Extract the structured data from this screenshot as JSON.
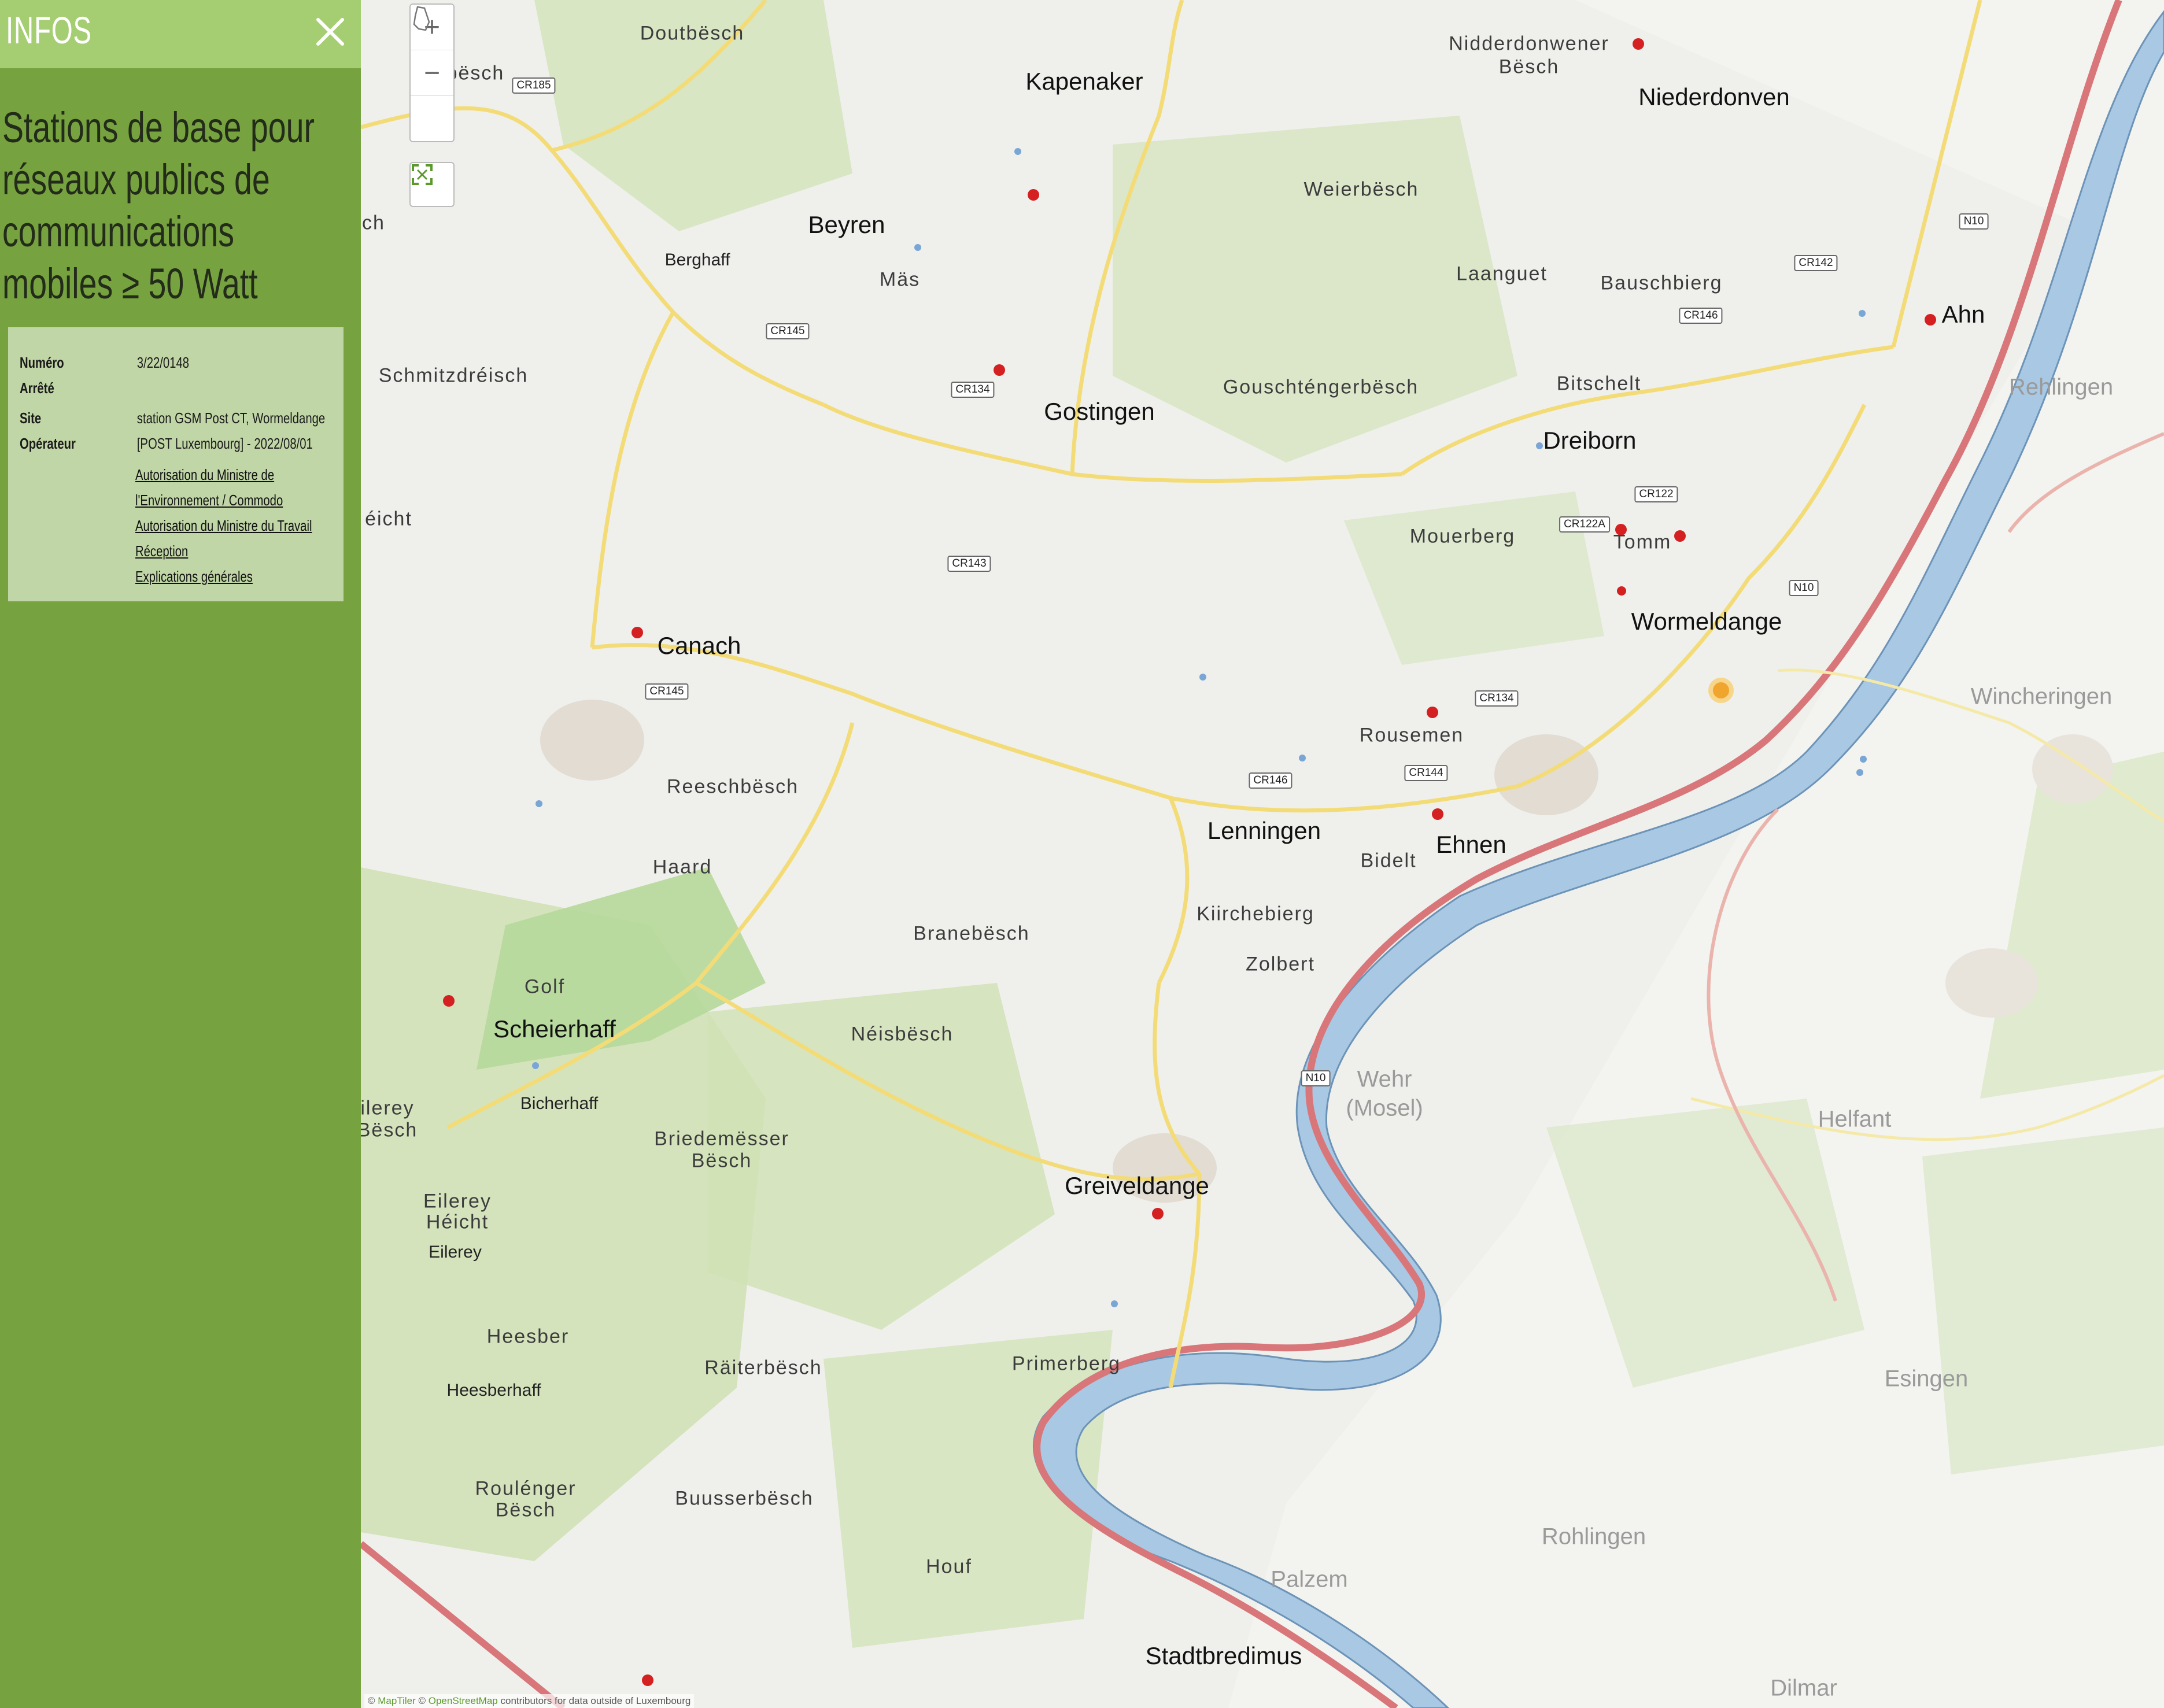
{
  "sidebar": {
    "title": "INFOS",
    "layer_title_lines": [
      "Stations de base pour",
      "réseaux publics de",
      "communications",
      "mobiles ≥ 50 Watt"
    ],
    "info": {
      "numero_label": "Numéro",
      "arrete_label": "Arrêté",
      "numero_value": "3/22/0148",
      "site_label": "Site",
      "site_value": "station GSM Post CT, Wormeldange",
      "operateur_label": "Opérateur",
      "operateur_value": "[POST Luxembourg] - 2022/08/01",
      "links": [
        "Autorisation du Ministre de",
        "l'Environnement / Commodo",
        "Autorisation du Ministre du Travail",
        "Réception",
        "Explications générales"
      ]
    }
  },
  "map": {
    "controls": {
      "zoom_in": "+",
      "zoom_out": "−"
    },
    "places": [
      {
        "name": "Doutbësch",
        "kind": "village"
      },
      {
        "name": "Kapenaker",
        "kind": "town"
      },
      {
        "name": "Nidderdonwener",
        "kind": "village"
      },
      {
        "name": "Bësch",
        "kind": "village"
      },
      {
        "name": "Niederdonven",
        "kind": "town"
      },
      {
        "name": "zebësch",
        "kind": "village"
      },
      {
        "name": "Beyren",
        "kind": "town"
      },
      {
        "name": "Weierbësch",
        "kind": "village"
      },
      {
        "name": "Berghaff",
        "kind": "hamlet"
      },
      {
        "name": "Mäs",
        "kind": "village"
      },
      {
        "name": "Laanguet",
        "kind": "village"
      },
      {
        "name": "Bauschbierg",
        "kind": "village"
      },
      {
        "name": "Ahn",
        "kind": "town"
      },
      {
        "name": "Rehlingen",
        "kind": "foreign"
      },
      {
        "name": "Schmitzdréisch",
        "kind": "village"
      },
      {
        "name": "Gostingen",
        "kind": "town"
      },
      {
        "name": "Gouschténgerbësch",
        "kind": "village"
      },
      {
        "name": "Bitschelt",
        "kind": "village"
      },
      {
        "name": "Dreiborn",
        "kind": "town"
      },
      {
        "name": "Mouerberg",
        "kind": "village"
      },
      {
        "name": "Tomm",
        "kind": "village"
      },
      {
        "name": "éicht",
        "kind": "village"
      },
      {
        "name": "Wormeldange",
        "kind": "town"
      },
      {
        "name": "Canach",
        "kind": "town"
      },
      {
        "name": "Wincheringen",
        "kind": "foreign"
      },
      {
        "name": "Rousemen",
        "kind": "village"
      },
      {
        "name": "Reeschbësch",
        "kind": "village"
      },
      {
        "name": "Lenningen",
        "kind": "town"
      },
      {
        "name": "Ehnen",
        "kind": "town"
      },
      {
        "name": "Bidelt",
        "kind": "village"
      },
      {
        "name": "Haard",
        "kind": "village"
      },
      {
        "name": "Branebësch",
        "kind": "village"
      },
      {
        "name": "Kiirchebierg",
        "kind": "village"
      },
      {
        "name": "Zolbert",
        "kind": "village"
      },
      {
        "name": "Golf",
        "kind": "village"
      },
      {
        "name": "Scheierhaff",
        "kind": "town"
      },
      {
        "name": "Néisbësch",
        "kind": "village"
      },
      {
        "name": "Wehr",
        "kind": "foreign"
      },
      {
        "name": "(Mosel)",
        "kind": "foreign"
      },
      {
        "name": "Bicherhaff",
        "kind": "hamlet"
      },
      {
        "name": "ilerey",
        "kind": "village"
      },
      {
        "name": "Bësch",
        "kind": "village"
      },
      {
        "name": "Helfant",
        "kind": "foreign"
      },
      {
        "name": "Briedemësser",
        "kind": "village"
      },
      {
        "name": "Bësch",
        "kind": "village"
      },
      {
        "name": "Greiveldange",
        "kind": "town"
      },
      {
        "name": "Eilerey",
        "kind": "village"
      },
      {
        "name": "Héicht",
        "kind": "village"
      },
      {
        "name": "Eilerey",
        "kind": "hamlet"
      },
      {
        "name": "Heesber",
        "kind": "village"
      },
      {
        "name": "Primerberg",
        "kind": "village"
      },
      {
        "name": "Räiterbësch",
        "kind": "village"
      },
      {
        "name": "Esingen",
        "kind": "foreign"
      },
      {
        "name": "Heesberhaff",
        "kind": "hamlet"
      },
      {
        "name": "Roulénger",
        "kind": "village"
      },
      {
        "name": "Bësch",
        "kind": "village"
      },
      {
        "name": "Buusserbësch",
        "kind": "village"
      },
      {
        "name": "Rohlingen",
        "kind": "foreign"
      },
      {
        "name": "Houf",
        "kind": "village"
      },
      {
        "name": "Palzem",
        "kind": "foreign"
      },
      {
        "name": "Stadtbredimus",
        "kind": "town"
      },
      {
        "name": "Dilmar",
        "kind": "foreign"
      },
      {
        "name": "ch",
        "kind": "village"
      }
    ],
    "roads": [
      "CR185",
      "CR145",
      "CR134",
      "CR143",
      "CR145",
      "CR146",
      "CR146",
      "CR144",
      "CR134",
      "CR142",
      "CR122",
      "CR122A",
      "N10",
      "N10",
      "N10"
    ],
    "attribution": {
      "maptiler": "MapTiler",
      "osm": "OpenStreetMap",
      "rest": "contributors for data outside of Luxembourg"
    },
    "colors": {
      "water": "#a9c8e3",
      "river_stroke": "#6c93b8",
      "motorway": "#d8767a",
      "road": "#f4e07a",
      "forest": "#c9dfae",
      "station": "#d42020",
      "selected": "#f0a62e"
    }
  }
}
